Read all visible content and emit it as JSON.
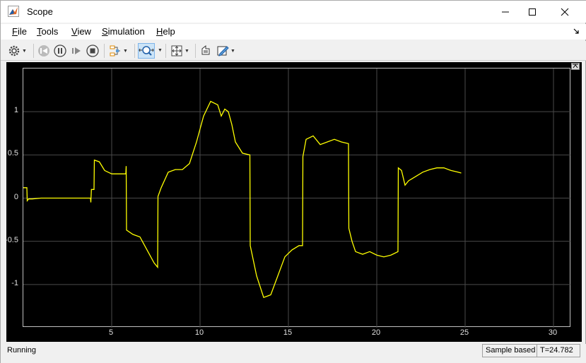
{
  "window": {
    "title": "Scope"
  },
  "menu": [
    {
      "label": "File",
      "hot": "F",
      "rest": "ile"
    },
    {
      "label": "Tools",
      "hot": "T",
      "rest": "ools"
    },
    {
      "label": "View",
      "hot": "V",
      "rest": "iew"
    },
    {
      "label": "Simulation",
      "hot": "S",
      "rest": "imulation"
    },
    {
      "label": "Help",
      "hot": "H",
      "rest": "elp"
    }
  ],
  "toolbar": {
    "buttons": [
      "settings-icon",
      "step-back-icon",
      "pause-icon",
      "step-forward-icon",
      "stop-icon",
      "signal-triggers-icon",
      "zoom-icon",
      "autoscale-icon",
      "highlight-icon",
      "edit-icon"
    ]
  },
  "status": {
    "state": "Running",
    "mode": "Sample based",
    "time": "T=24.782"
  },
  "colors": {
    "signal": "#ffff00",
    "grid": "#4a4a4a",
    "background": "#000000"
  },
  "chart_data": {
    "type": "line",
    "xlim": [
      0,
      31
    ],
    "ylim": [
      -1.5,
      1.5
    ],
    "xticks": [
      5,
      10,
      15,
      20,
      25,
      30
    ],
    "yticks": [
      1,
      0.5,
      0,
      -0.5,
      -1
    ],
    "ytick_labels": [
      "1",
      "0.5",
      "0",
      "-0.5",
      "-1"
    ],
    "grid": true,
    "series": [
      {
        "x": [
          0,
          0.2,
          0.22,
          0.3,
          0.5,
          1,
          2,
          3,
          3.8,
          3.82,
          3.85,
          4.0,
          4.02,
          4.3,
          4.6,
          5,
          5.4,
          5.8,
          5.82,
          5.84,
          6.2,
          6.6,
          7.0,
          7.4,
          7.6,
          7.62,
          7.8,
          8.2,
          8.6,
          9.0,
          9.4,
          9.8,
          10.2,
          10.6,
          11.0,
          11.2,
          11.4,
          11.6,
          11.8,
          12.0,
          12.4,
          12.8,
          12.82,
          12.84,
          13.2,
          13.6,
          14.0,
          14.4,
          14.8,
          15.2,
          15.6,
          15.8,
          15.82,
          16.0,
          16.4,
          16.8,
          17.2,
          17.6,
          18.0,
          18.4,
          18.42,
          18.6,
          18.8,
          19.2,
          19.6,
          20.0,
          20.4,
          20.8,
          21.2,
          21.22,
          21.4,
          21.6,
          21.8,
          22.2,
          22.6,
          23.0,
          23.4,
          23.8,
          24.2,
          24.6,
          24.78
        ],
        "y": [
          0.12,
          0.12,
          -0.03,
          -0.01,
          -0.01,
          0.0,
          0.0,
          0.0,
          0.0,
          -0.05,
          0.1,
          0.1,
          0.44,
          0.42,
          0.32,
          0.28,
          0.28,
          0.28,
          0.37,
          -0.37,
          -0.42,
          -0.45,
          -0.6,
          -0.75,
          -0.8,
          0.02,
          0.12,
          0.3,
          0.33,
          0.33,
          0.4,
          0.65,
          0.95,
          1.12,
          1.08,
          0.95,
          1.03,
          1.0,
          0.85,
          0.65,
          0.52,
          0.5,
          0.5,
          -0.55,
          -0.9,
          -1.15,
          -1.12,
          -0.9,
          -0.68,
          -0.6,
          -0.55,
          -0.55,
          0.48,
          0.68,
          0.72,
          0.62,
          0.65,
          0.68,
          0.65,
          0.63,
          -0.35,
          -0.5,
          -0.62,
          -0.65,
          -0.62,
          -0.66,
          -0.68,
          -0.66,
          -0.62,
          0.35,
          0.32,
          0.15,
          0.2,
          0.25,
          0.3,
          0.33,
          0.35,
          0.35,
          0.32,
          0.3,
          0.29
        ]
      }
    ]
  }
}
